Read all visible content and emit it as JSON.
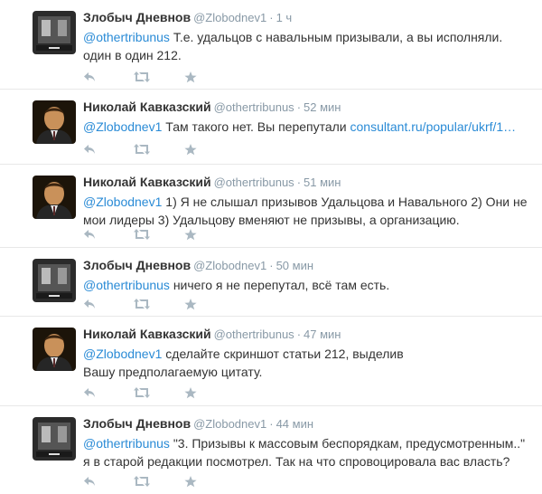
{
  "colors": {
    "link": "#2a8bd6",
    "meta": "#8899a6",
    "icon": "#aab8c2"
  },
  "tweets": [
    {
      "fullname": "Злобыч Дневнов",
      "username": "@Zlobodnev1",
      "sep": "·",
      "time": "1 ч",
      "avatar": "zlobych",
      "mention": "@othertribunus",
      "text": " Т.е. удальцов с навальным призывали, а вы исполняли. один в один 212.",
      "link": ""
    },
    {
      "fullname": "Николай Кавказский",
      "username": "@othertribunus",
      "sep": "·",
      "time": "52 мин",
      "avatar": "nikolai",
      "mention": "@Zlobodnev1",
      "text": " Там такого нет. Вы перепутали ",
      "link": "consultant.ru/popular/ukrf/1…"
    },
    {
      "fullname": "Николай Кавказский",
      "username": "@othertribunus",
      "sep": "·",
      "time": "51 мин",
      "avatar": "nikolai",
      "mention": "@Zlobodnev1",
      "text": " 1) Я не слышал призывов Удальцова и Навального 2) Они не мои лидеры 3) Удальцову вменяют не призывы, а организацию.",
      "link": ""
    },
    {
      "fullname": "Злобыч Дневнов",
      "username": "@Zlobodnev1",
      "sep": "·",
      "time": "50 мин",
      "avatar": "zlobych",
      "mention": "@othertribunus",
      "text": " ничего я не перепутал, всё там есть.",
      "link": ""
    },
    {
      "fullname": "Николай Кавказский",
      "username": "@othertribunus",
      "sep": "·",
      "time": "47 мин",
      "avatar": "nikolai",
      "mention": "@Zlobodnev1",
      "text": " сделайте скриншот статьи 212, выделив Вашу предполагаемую цитату.",
      "link": ""
    },
    {
      "fullname": "Злобыч Дневнов",
      "username": "@Zlobodnev1",
      "sep": "·",
      "time": "44 мин",
      "avatar": "zlobych",
      "mention": "@othertribunus",
      "text": " \"3. Призывы к массовым беспорядкам, предусмотренным..\" я в старой редакции посмотрел. Так на что спровоцировала вас власть?",
      "link": ""
    }
  ]
}
